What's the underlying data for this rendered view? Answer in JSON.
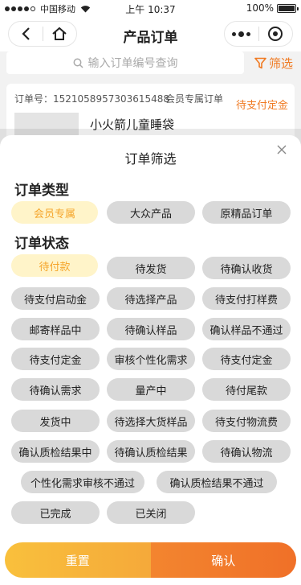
{
  "status_bar": {
    "carrier": "中国移动",
    "time": "上午 10:37",
    "battery": "100%"
  },
  "nav": {
    "title": "产品订单",
    "icons": [
      "back-icon",
      "home-icon",
      "more-icon",
      "target-icon"
    ]
  },
  "search": {
    "placeholder": "输入订单编号查询",
    "filter_label": "筛选"
  },
  "order": {
    "number": "订单号：1521058957303615488",
    "type": "会员专属订单",
    "status": "待支付定金",
    "name": "小火箭儿童睡袋"
  },
  "filter_sheet": {
    "title": "订单筛选",
    "order_type_label": "订单类型",
    "order_types": [
      {
        "label": "会员专属",
        "selected": true
      },
      {
        "label": "大众产品",
        "selected": false
      },
      {
        "label": "原精品订单",
        "selected": false
      }
    ],
    "order_status_label": "订单状态",
    "order_statuses": [
      {
        "label": "待付款",
        "selected": true
      },
      {
        "label": "待发货",
        "selected": false
      },
      {
        "label": "待确认收货",
        "selected": false
      },
      {
        "label": "待支付启动金",
        "selected": false
      },
      {
        "label": "待选择产品",
        "selected": false
      },
      {
        "label": "待支付打样费",
        "selected": false
      },
      {
        "label": "邮寄样品中",
        "selected": false
      },
      {
        "label": "待确认样品",
        "selected": false
      },
      {
        "label": "确认样品不通过",
        "selected": false
      },
      {
        "label": "待支付定金",
        "selected": false
      },
      {
        "label": "审核个性化需求",
        "selected": false
      },
      {
        "label": "待支付定金",
        "selected": false
      },
      {
        "label": "待确认需求",
        "selected": false
      },
      {
        "label": "量产中",
        "selected": false
      },
      {
        "label": "待付尾款",
        "selected": false
      },
      {
        "label": "发货中",
        "selected": false
      },
      {
        "label": "待选择大货样品",
        "selected": false
      },
      {
        "label": "待支付物流费",
        "selected": false
      },
      {
        "label": "确认质检结果中",
        "selected": false
      },
      {
        "label": "待确认质检结果",
        "selected": false
      },
      {
        "label": "待确认物流",
        "selected": false
      },
      {
        "label": "个性化需求审核不通过",
        "selected": false
      },
      {
        "label": "确认质检结果不通过",
        "selected": false
      },
      {
        "label": "已完成",
        "selected": false
      },
      {
        "label": "已关闭",
        "selected": false
      }
    ],
    "reset_label": "重置",
    "confirm_label": "确认"
  },
  "colors": {
    "accent": "#f07a22",
    "selected_bg": "#fff4c9",
    "selected_text": "#f5a52b",
    "pill_bg": "#d9d9d9"
  }
}
